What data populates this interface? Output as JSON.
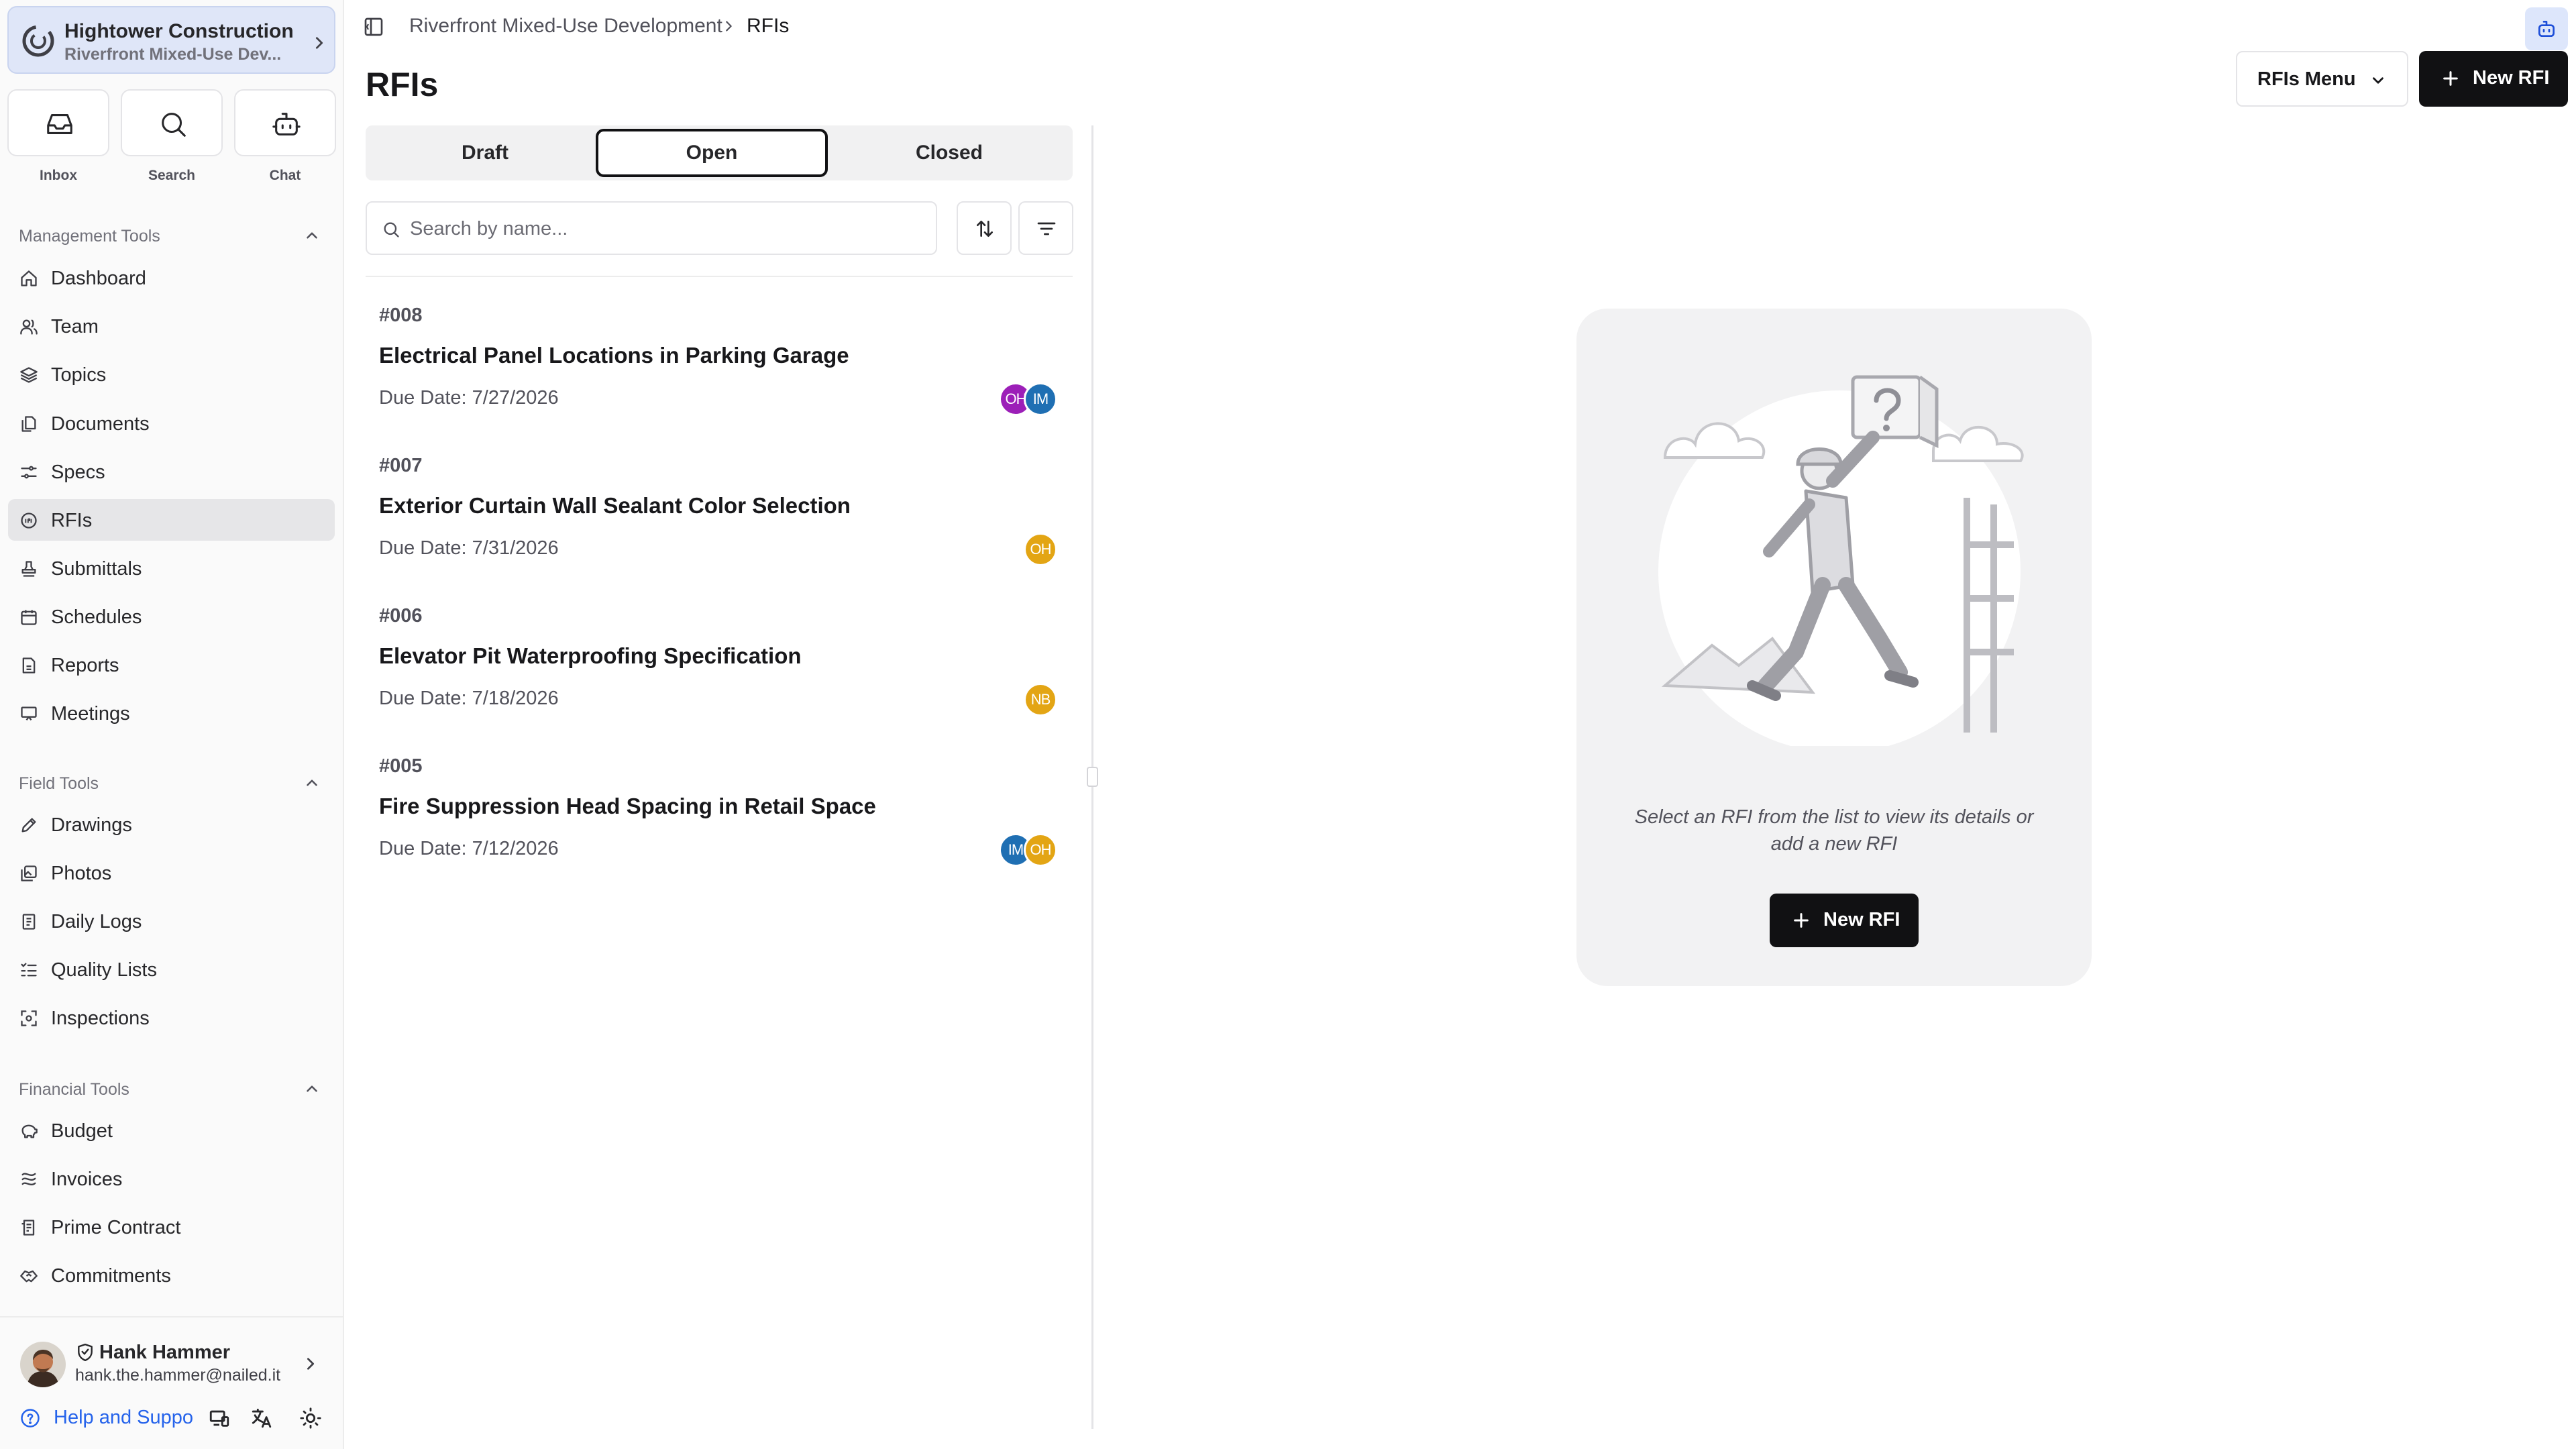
{
  "org": {
    "name": "Hightower Construction",
    "project": "Riverfront Mixed-Use Dev..."
  },
  "quick": {
    "inbox": "Inbox",
    "search": "Search",
    "chat": "Chat"
  },
  "sections": {
    "management": "Management Tools",
    "field": "Field Tools",
    "financial": "Financial Tools"
  },
  "nav": {
    "management": [
      {
        "label": "Dashboard",
        "icon": "home-icon"
      },
      {
        "label": "Team",
        "icon": "users-icon"
      },
      {
        "label": "Topics",
        "icon": "layers-icon"
      },
      {
        "label": "Documents",
        "icon": "files-icon"
      },
      {
        "label": "Specs",
        "icon": "sliders-icon"
      },
      {
        "label": "RFIs",
        "icon": "rfi-icon",
        "active": true
      },
      {
        "label": "Submittals",
        "icon": "stamp-icon"
      },
      {
        "label": "Schedules",
        "icon": "calendar-icon"
      },
      {
        "label": "Reports",
        "icon": "report-icon"
      },
      {
        "label": "Meetings",
        "icon": "presentation-icon"
      }
    ],
    "field": [
      {
        "label": "Drawings",
        "icon": "pen-icon"
      },
      {
        "label": "Photos",
        "icon": "images-icon"
      },
      {
        "label": "Daily Logs",
        "icon": "notebook-icon"
      },
      {
        "label": "Quality Lists",
        "icon": "checklist-icon"
      },
      {
        "label": "Inspections",
        "icon": "scan-icon"
      }
    ],
    "financial": [
      {
        "label": "Budget",
        "icon": "piggy-bank-icon"
      },
      {
        "label": "Invoices",
        "icon": "invoice-icon"
      },
      {
        "label": "Prime Contract",
        "icon": "contract-icon"
      },
      {
        "label": "Commitments",
        "icon": "handshake-icon"
      }
    ]
  },
  "user": {
    "name": "Hank Hammer",
    "email": "hank.the.hammer@nailed.it"
  },
  "help": "Help and Suppo",
  "breadcrumb": {
    "parent": "Riverfront Mixed-Use Development",
    "current": "RFIs"
  },
  "page": {
    "title": "RFIs",
    "menu_label": "RFIs Menu",
    "new_label": "New RFI"
  },
  "tabs": [
    "Draft",
    "Open",
    "Closed"
  ],
  "active_tab": "Open",
  "search": {
    "placeholder": "Search by name...",
    "value": ""
  },
  "rfis": [
    {
      "number": "#008",
      "title": "Electrical Panel Locations in Parking Garage",
      "due": "Due Date: 7/27/2026",
      "assignees": [
        {
          "initials": "OH",
          "color": "#9c1fb8"
        },
        {
          "initials": "IM",
          "color": "#1f6fb3"
        }
      ]
    },
    {
      "number": "#007",
      "title": "Exterior Curtain Wall Sealant Color Selection",
      "due": "Due Date: 7/31/2026",
      "assignees": [
        {
          "initials": "OH",
          "color": "#e3a514"
        }
      ]
    },
    {
      "number": "#006",
      "title": "Elevator Pit Waterproofing Specification",
      "due": "Due Date: 7/18/2026",
      "assignees": [
        {
          "initials": "NB",
          "color": "#e3a514"
        }
      ]
    },
    {
      "number": "#005",
      "title": "Fire Suppression Head Spacing in Retail Space",
      "due": "Due Date: 7/12/2026",
      "assignees": [
        {
          "initials": "IM",
          "color": "#1f6fb3"
        },
        {
          "initials": "OH",
          "color": "#e3a514"
        }
      ]
    }
  ],
  "empty_state": {
    "message": "Select an RFI from the list to view its details or add a new RFI",
    "button": "New RFI"
  }
}
